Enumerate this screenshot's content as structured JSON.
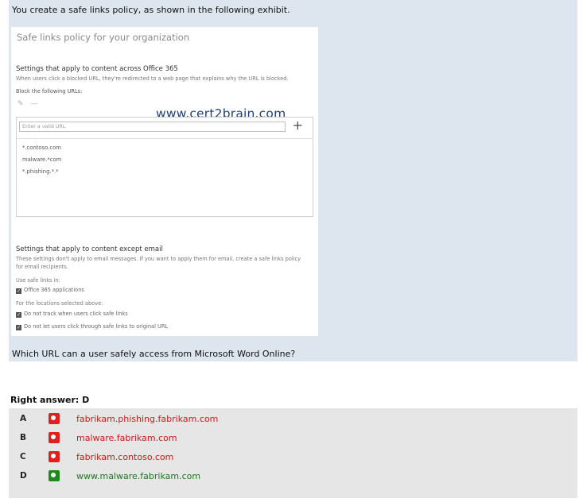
{
  "intro": "You create a safe links policy, as shown in the following exhibit.",
  "exhibit": {
    "title": "Safe links policy for your organization",
    "section1": {
      "heading": "Settings that apply to content across Office 365",
      "desc": "When users click a blocked URL, they're redirected to a web page that explains why the URL is blocked.",
      "block_label": "Block the following URLs:",
      "edit_icon": "pencil-icon",
      "remove_icon": "minus-icon",
      "input_placeholder": "Enter a valid URL",
      "add_label": "+",
      "urls": [
        "*.contoso.com",
        "malware.*com",
        "*.phishing.*.*"
      ]
    },
    "watermark": "www.cert2brain.com",
    "section2": {
      "heading": "Settings that apply to content except email",
      "desc_line1": "These settings don't apply to email messages. If you want to apply them for email, create a safe links policy",
      "desc_line2": "for email recipients.",
      "use_label": "Use safe links in:",
      "office_apps": "Office 365 applications",
      "locations_label": "For the locations selected above:",
      "no_track": "Do not track when users click safe links",
      "no_click_through": "Do not let users click through safe links to original URL"
    }
  },
  "question": "Which URL can a user safely access from Microsoft Word Online?",
  "right_answer": "Right answer: D",
  "options": [
    {
      "letter": "A",
      "text": "fabrikam.phishing.fabrikam.com",
      "correct": false
    },
    {
      "letter": "B",
      "text": "malware.fabrikam.com",
      "correct": false
    },
    {
      "letter": "C",
      "text": "fabrikam.contoso.com",
      "correct": false
    },
    {
      "letter": "D",
      "text": "www.malware.fabrikam.com",
      "correct": true
    }
  ],
  "colors": {
    "wrong": "#e02020",
    "right": "#1e8a1e",
    "question_bg": "#dde6ef",
    "answers_bg": "#e6e6e6"
  }
}
